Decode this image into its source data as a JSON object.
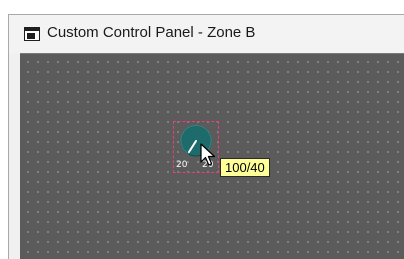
{
  "window": {
    "title": "Custom Control Panel - Zone B",
    "icon": "window-app-icon"
  },
  "canvas": {
    "background_color": "#5b5b5b",
    "grid": true
  },
  "knob": {
    "icon": "rotary-knob-icon",
    "fill_color": "#1d6b6b",
    "selection_color": "#e0417a",
    "min_label": "20",
    "max_label": "20"
  },
  "tooltip": {
    "text": "100/40"
  },
  "cursor": {
    "icon": "arrow-cursor-icon"
  }
}
